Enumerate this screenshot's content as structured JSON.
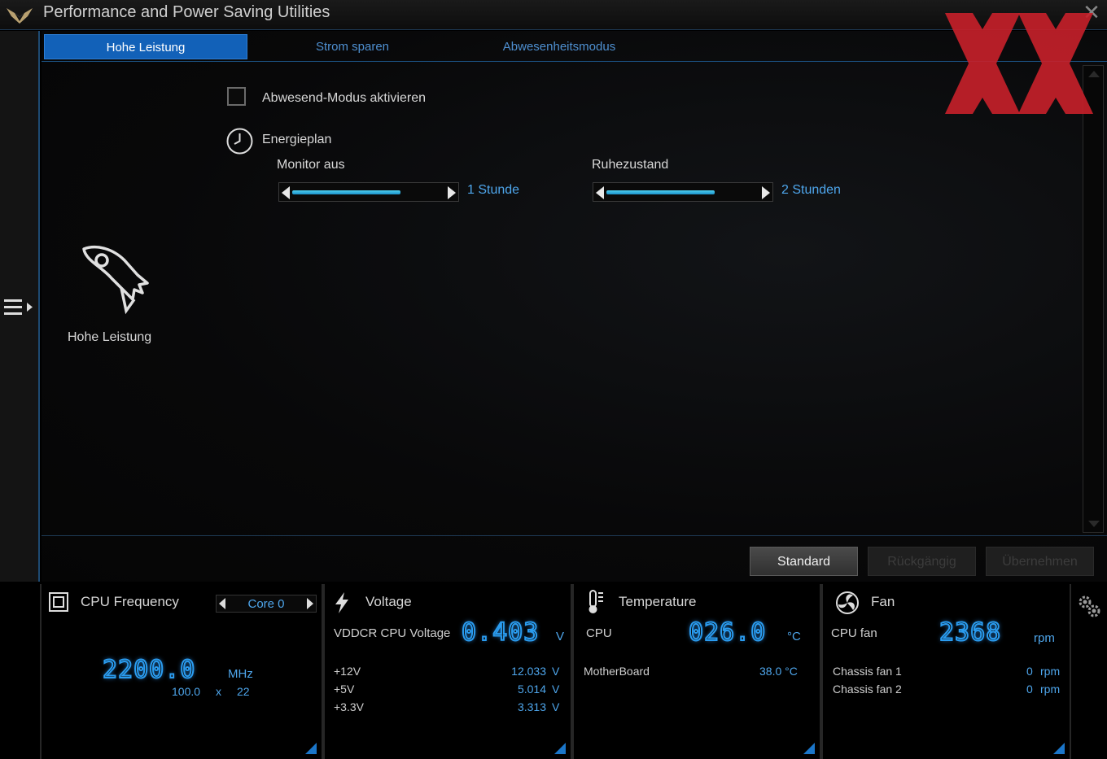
{
  "window": {
    "title": "Performance and Power Saving Utilities"
  },
  "tabs": [
    {
      "label": "Hohe Leistung",
      "active": true
    },
    {
      "label": "Strom sparen",
      "active": false
    },
    {
      "label": "Abwesenheitsmodus",
      "active": false
    }
  ],
  "settings": {
    "away_mode_label": "Abwesend-Modus aktivieren",
    "away_mode_checked": false,
    "energy_plan_label": "Energieplan",
    "monitor_off": {
      "label": "Monitor aus",
      "value": "1 Stunde",
      "level": 0.7
    },
    "sleep": {
      "label": "Ruhezustand",
      "value": "2 Stunden",
      "level": 0.7
    }
  },
  "mode_profile": {
    "label": "Hohe Leistung",
    "icon": "rocket-icon"
  },
  "buttons": {
    "standard": "Standard",
    "undo": "Rückgängig",
    "apply": "Übernehmen"
  },
  "monitor": {
    "cpu_frequency": {
      "title": "CPU Frequency",
      "core_selector": "Core 0",
      "value": "2200.0",
      "unit": "MHz",
      "bclk": "100.0",
      "x": "x",
      "multiplier": "22"
    },
    "voltage": {
      "title": "Voltage",
      "main_label": "VDDCR CPU Voltage",
      "main_value": "0.403",
      "main_unit": "V",
      "rows": [
        {
          "label": "+12V",
          "value": "12.033",
          "unit": "V"
        },
        {
          "label": "+5V",
          "value": "5.014",
          "unit": "V"
        },
        {
          "label": "+3.3V",
          "value": "3.313",
          "unit": "V"
        }
      ]
    },
    "temperature": {
      "title": "Temperature",
      "main_label": "CPU",
      "main_value": "026.0",
      "main_unit": "°C",
      "rows": [
        {
          "label": "MotherBoard",
          "value": "38.0 °C"
        }
      ]
    },
    "fan": {
      "title": "Fan",
      "main_label": "CPU fan",
      "main_value": "2368",
      "main_unit": "rpm",
      "rows": [
        {
          "label": "Chassis fan 1",
          "value": "0",
          "unit": "rpm"
        },
        {
          "label": "Chassis fan 2",
          "value": "0",
          "unit": "rpm"
        }
      ]
    }
  },
  "colors": {
    "accent": "#1261b8",
    "value_blue": "#4ea6ec",
    "watermark_red": "#c8202a"
  }
}
